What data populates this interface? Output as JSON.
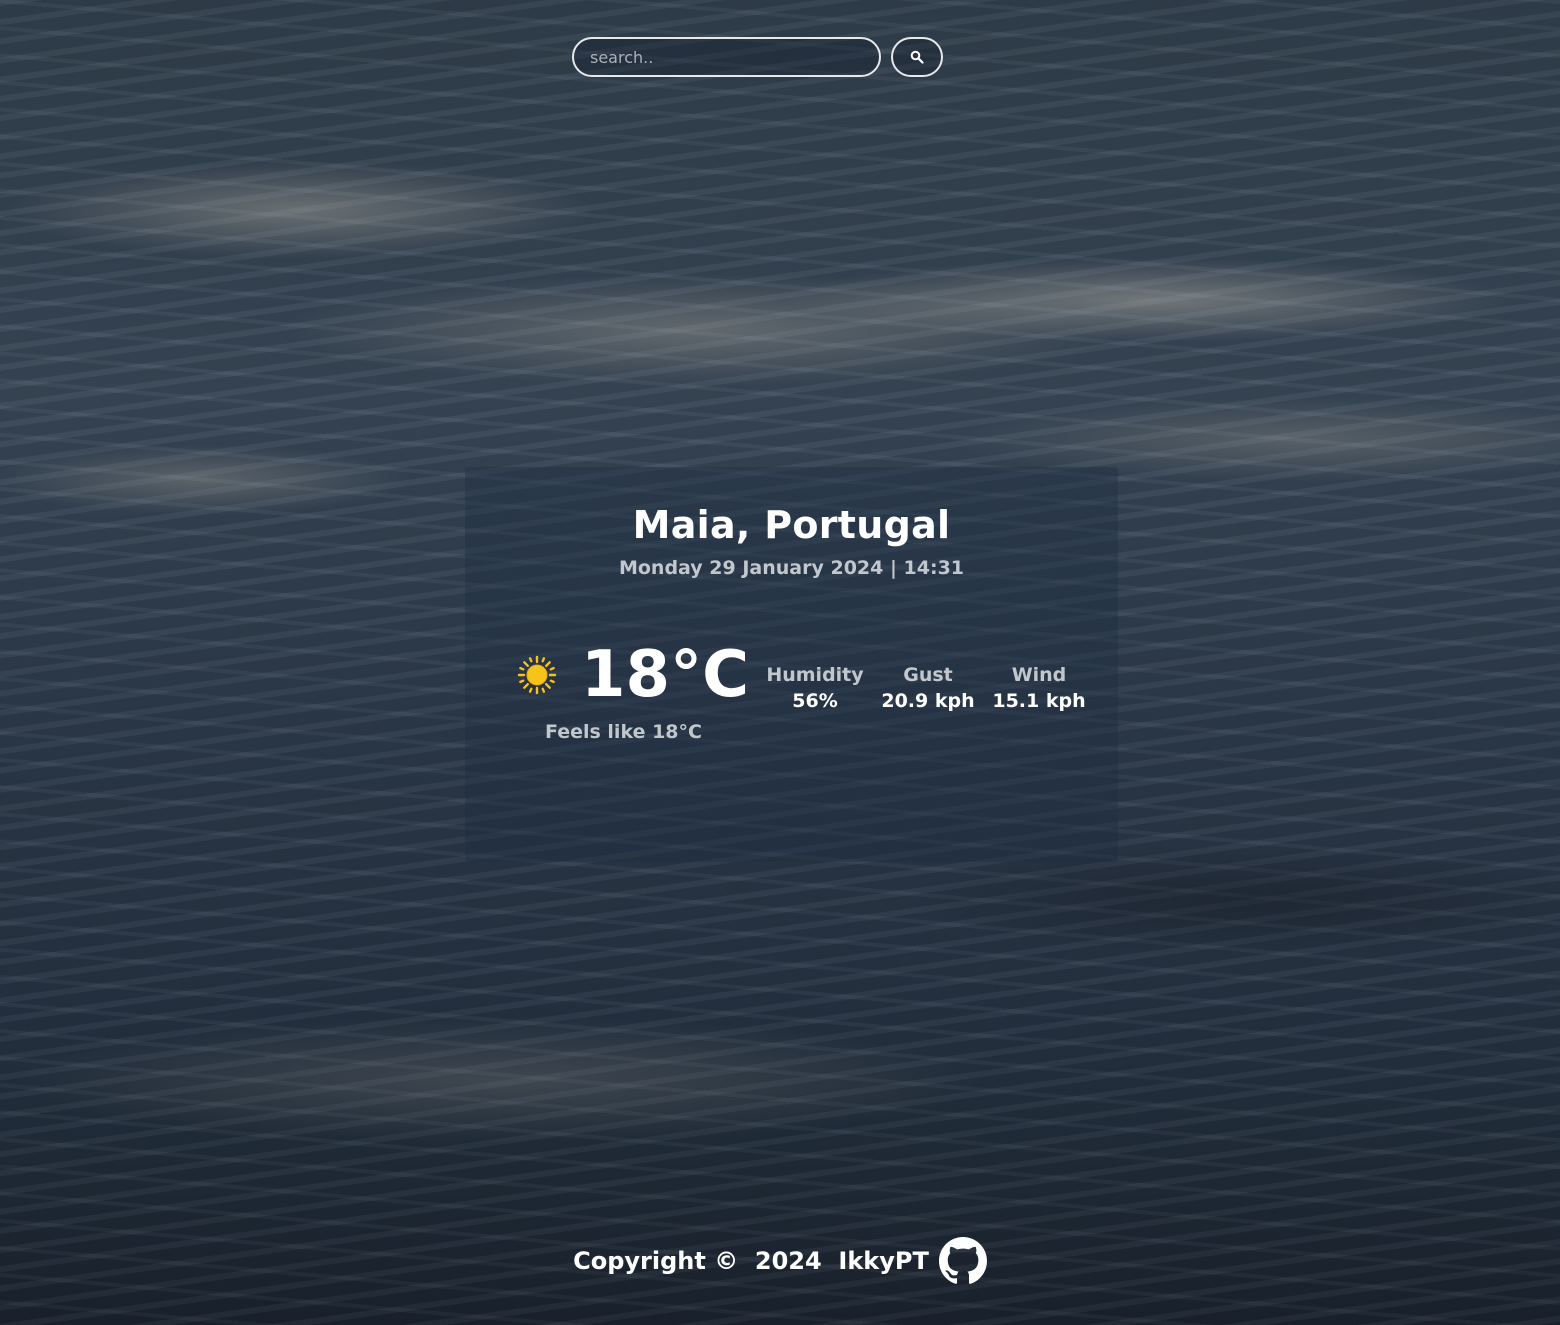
{
  "search": {
    "placeholder": "search..",
    "value": "",
    "button_icon": "search-icon"
  },
  "weather": {
    "location": "Maia, Portugal",
    "datetime": "Monday 29 January 2024 | 14:31",
    "condition_icon": "sun-icon",
    "temperature": "18°C",
    "feels_like": "Feels like 18°C",
    "stats": [
      {
        "label": "Humidity",
        "value": "56%"
      },
      {
        "label": "Gust",
        "value": "20.9 kph"
      },
      {
        "label": "Wind",
        "value": "15.1 kph"
      }
    ]
  },
  "footer": {
    "copyright": "Copyright ©  2024  IkkyPT",
    "link_icon": "github-icon"
  },
  "colors": {
    "text_primary": "#ffffff",
    "text_secondary": "#c2c7cd",
    "sun": "#f7c21a",
    "input_border": "#e6e8ea"
  }
}
